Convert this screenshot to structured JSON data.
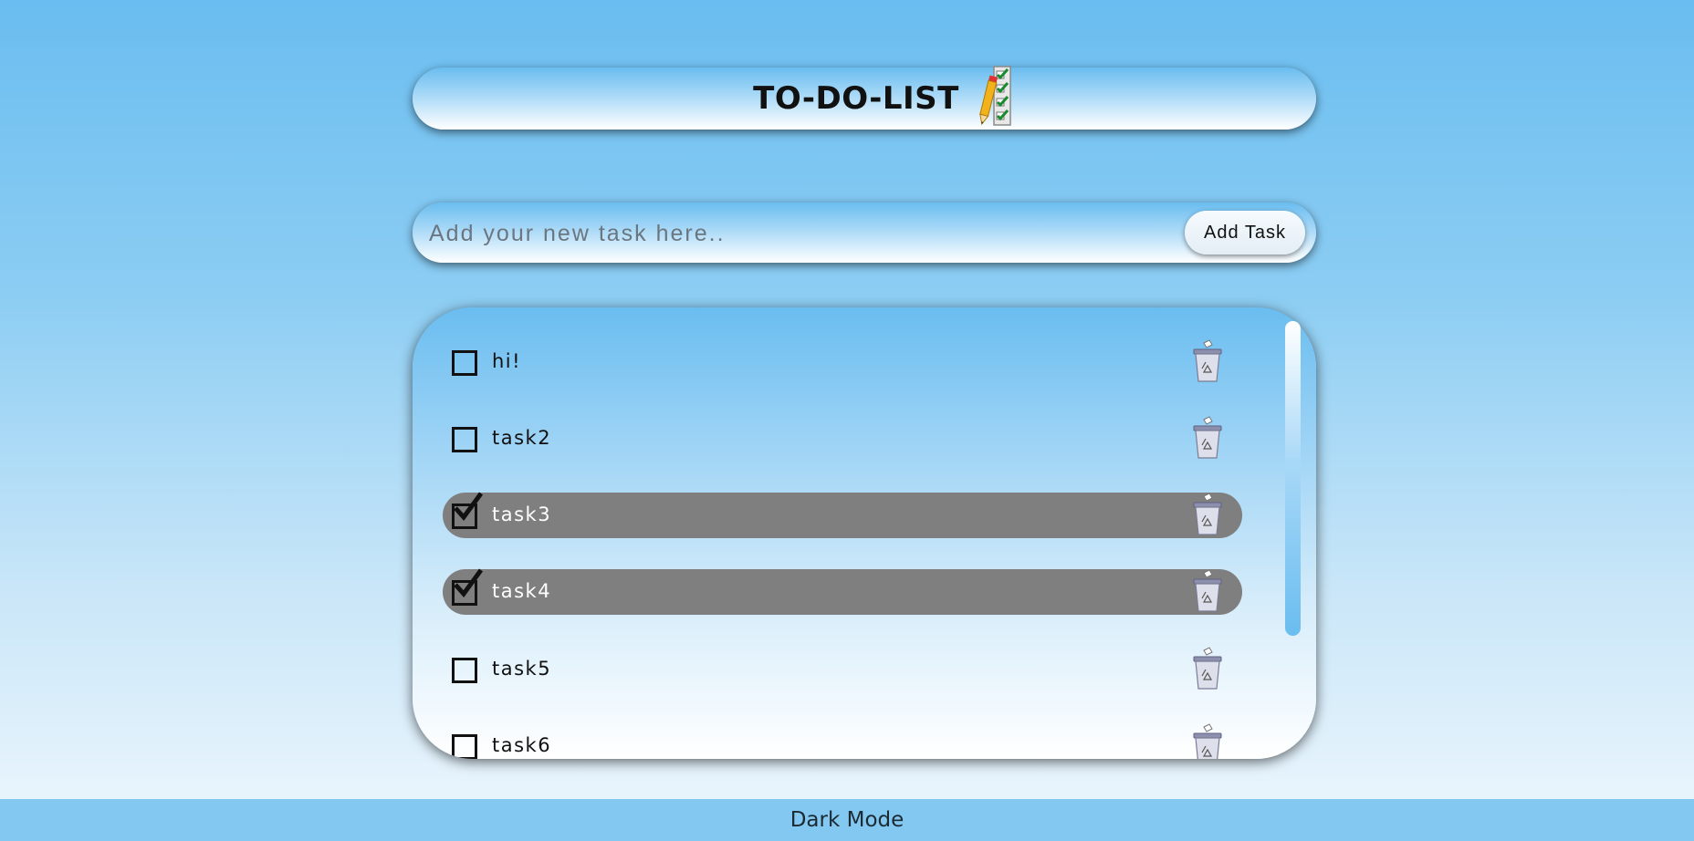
{
  "header": {
    "title": "TO-DO-LIST",
    "icon": "pencil-checklist-icon"
  },
  "input": {
    "placeholder": "Add your new task here..",
    "value": "",
    "add_button_label": "Add Task"
  },
  "tasks": [
    {
      "text": "hi!",
      "done": false
    },
    {
      "text": "task2",
      "done": false
    },
    {
      "text": "task3",
      "done": true
    },
    {
      "text": "task4",
      "done": true
    },
    {
      "text": "task5",
      "done": false
    },
    {
      "text": "task6",
      "done": false
    }
  ],
  "icons": {
    "delete": "trash-bin-icon",
    "check": "checkmark-icon"
  },
  "footer": {
    "dark_mode_label": "Dark Mode"
  },
  "colors": {
    "accent": "#6abdf0",
    "done_row": "#7f7f7f",
    "footer": "#82c8f0",
    "check_green": "#1a8a2e"
  }
}
